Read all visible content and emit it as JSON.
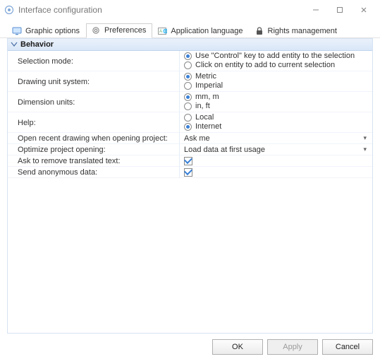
{
  "window": {
    "title": "Interface configuration"
  },
  "tabs": {
    "graphic": "Graphic options",
    "preferences": "Preferences",
    "language": "Application language",
    "rights": "Rights management"
  },
  "section": {
    "header": "Behavior"
  },
  "labels": {
    "selection_mode": "Selection mode:",
    "drawing_unit": "Drawing unit system:",
    "dimension_units": "Dimension units:",
    "help": "Help:",
    "open_recent": "Open recent drawing when opening project:",
    "optimize": "Optimize project opening:",
    "ask_translated": "Ask to remove translated text:",
    "send_anon": "Send anonymous data:"
  },
  "options": {
    "selection_mode": {
      "control": "Use \"Control\" key to add entity to the selection",
      "click": "Click on entity to add to current selection"
    },
    "drawing_unit": {
      "metric": "Metric",
      "imperial": "Imperial"
    },
    "dimension_units": {
      "mm": "mm, m",
      "in": "in, ft"
    },
    "help": {
      "local": "Local",
      "internet": "Internet"
    },
    "open_recent": "Ask me",
    "optimize": "Load data at first usage"
  },
  "buttons": {
    "ok": "OK",
    "apply": "Apply",
    "cancel": "Cancel"
  }
}
